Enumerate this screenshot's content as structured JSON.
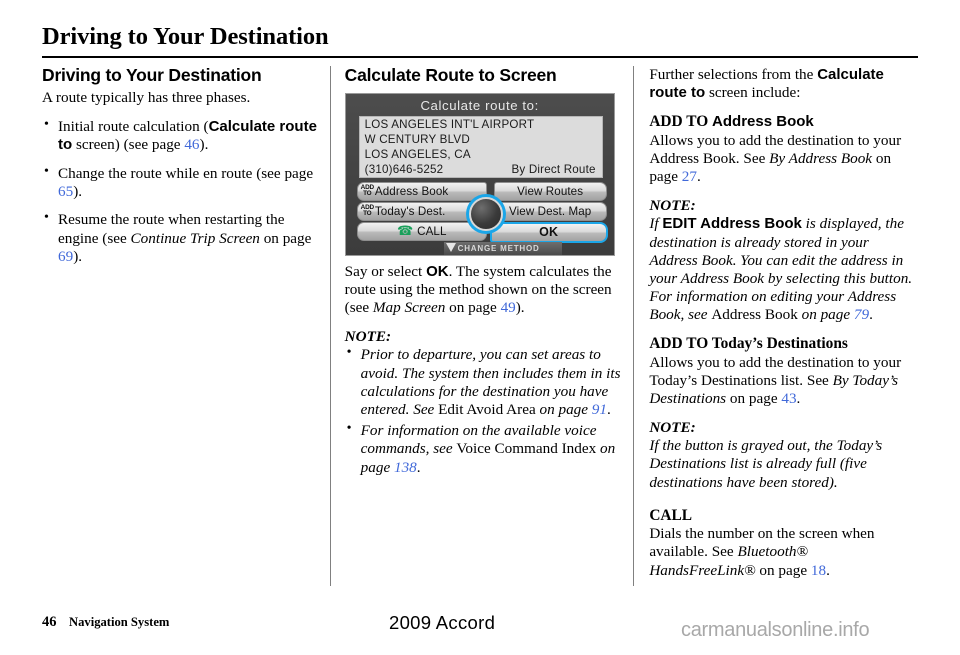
{
  "header": {
    "title": "Driving to Your Destination"
  },
  "left_column": {
    "heading": "Driving to Your Destination",
    "intro": "A route typically has three phases.",
    "bullets": [
      {
        "pre": "Initial route calculation (",
        "sans_bold": "Calculate route to",
        "mid": " screen) (see page ",
        "page": "46",
        "post": ")."
      },
      {
        "pre": "Change the route while en route (see page ",
        "sans_bold": "",
        "mid": "",
        "page": "65",
        "post": ")."
      },
      {
        "pre": "Resume the route when restarting the engine (see ",
        "italic": "Continue Trip Screen",
        "mid": " on page ",
        "page": "69",
        "post": ")."
      }
    ]
  },
  "mid_column": {
    "heading": "Calculate Route to Screen",
    "nav_screen": {
      "title": "Calculate route to:",
      "destination_lines": [
        "LOS ANGELES INT'L AIRPORT",
        "W CENTURY BLVD",
        "LOS ANGELES, CA",
        "(310)646-5252"
      ],
      "route_method": "By Direct Route",
      "buttons": {
        "add_to_prefix": "ADD TO",
        "address_book": "Address Book",
        "todays_dest": "Today's Dest.",
        "call": "CALL",
        "view_routes": "View Routes",
        "view_dest_map": "View Dest. Map",
        "ok": "OK"
      },
      "change_method": "CHANGE METHOD",
      "highlight_color": "#1ba6e8",
      "call_icon_color": "#18a05a"
    },
    "body": {
      "p1_a": "Say or select ",
      "p1_ok": "OK",
      "p1_b": ". The system calculates the route using the method shown on the screen (see ",
      "p1_italic": "Map Screen",
      "p1_c": " on page ",
      "p1_page": "49",
      "p1_d": ")."
    },
    "note_label": "NOTE:",
    "note_bullets": [
      {
        "italic_a": "Prior to departure, you can set areas to avoid. The system then includes them in its calculations for the destination you have entered. See ",
        "roman": "Edit Avoid Area",
        "italic_b": " on page ",
        "page": "91",
        "end": "."
      },
      {
        "italic_a": "For information on the available voice commands, see ",
        "roman": "Voice Command Index",
        "italic_b": " on page ",
        "page": "138",
        "end": "."
      }
    ]
  },
  "right_column": {
    "intro_a": "Further selections from the ",
    "intro_sans": "Calculate route to",
    "intro_b": " screen include:",
    "section1": {
      "heading_bold": "ADD TO ",
      "heading_sans": "Address Book",
      "body_a": "Allows you to add the destination to your Address Book. See ",
      "body_italic": "By Address Book",
      "body_b": " on page ",
      "page": "27",
      "body_c": ".",
      "note_label": "NOTE:",
      "note_a": "If ",
      "note_sans": "EDIT Address Book",
      "note_b": " is displayed, the destination is already stored in your Address Book. You can edit the address in your Address Book by selecting this button. For information on editing your Address Book, see ",
      "note_roman": "Address Book",
      "note_c": " on page ",
      "note_page": "79",
      "note_d": "."
    },
    "section2": {
      "heading": "ADD TO Today’s Destinations",
      "body_a": "Allows you to add the destination to your Today’s Destinations list. See ",
      "body_italic": "By Today’s Destinations",
      "body_b": " on page ",
      "page": "43",
      "body_c": ".",
      "note_label": "NOTE:",
      "note": "If the button is grayed out, the Today’s Destinations list is already full (five destinations have been stored)."
    },
    "section3": {
      "heading": "CALL",
      "body_a": "Dials the number on the screen when available. See ",
      "body_italic": "Bluetooth® HandsFreeLink®",
      "body_b": " on page ",
      "page": "18",
      "body_c": "."
    }
  },
  "footer": {
    "page_number": "46",
    "section_name": "Navigation System",
    "model": "2009  Accord",
    "watermark": "carmanualsonline.info"
  }
}
